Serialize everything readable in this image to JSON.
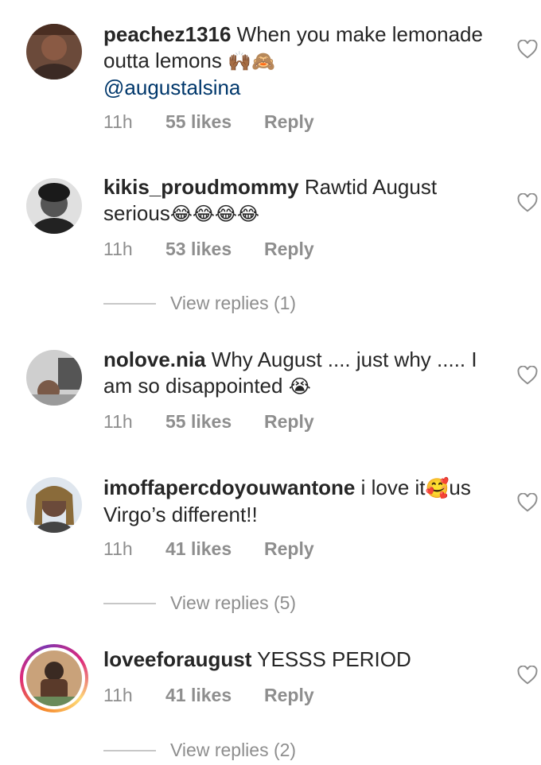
{
  "comments": [
    {
      "username": "peachez1316",
      "text": " When you make lemonade outta lemons ",
      "emojis": "🙌🏾🙈",
      "mention": "@augustalsina",
      "time": "11h",
      "likes": "55 likes",
      "reply": "Reply"
    },
    {
      "username": "kikis_proudmommy",
      "text": " Rawtid August serious",
      "emojis": "😂😂😂😂",
      "time": "11h",
      "likes": "53 likes",
      "reply": "Reply",
      "view_replies": "View replies (1)"
    },
    {
      "username": "nolove.nia",
      "text": " Why August .... just why ..... I am so disappointed ",
      "emojis": "😭",
      "time": "11h",
      "likes": "55 likes",
      "reply": "Reply"
    },
    {
      "username": "imoffapercdoyouwantone",
      "text": " i love it",
      "emojis": "🥰",
      "text2": "us Virgo’s different!!",
      "time": "11h",
      "likes": "41 likes",
      "reply": "Reply",
      "view_replies": "View replies (5)"
    },
    {
      "username": "loveeforaugust",
      "text": " YESSS PERIOD",
      "time": "11h",
      "likes": "41 likes",
      "reply": "Reply",
      "view_replies": "View replies (2)"
    }
  ],
  "icons": {
    "like": "heart-outline-icon"
  },
  "colors": {
    "mention": "#00376b",
    "meta": "#8e8e8e",
    "text": "#262626"
  }
}
